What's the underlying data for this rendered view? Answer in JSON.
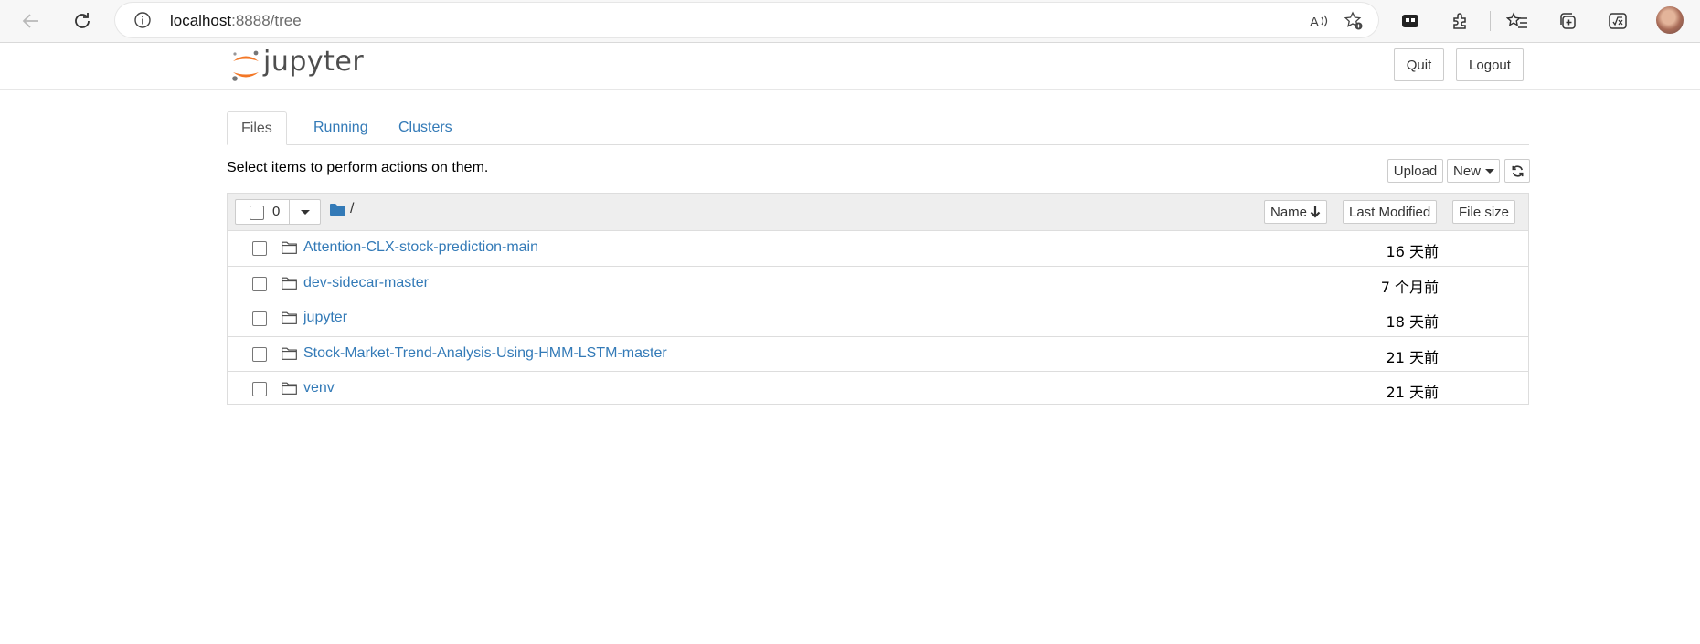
{
  "browser": {
    "url_host": "localhost",
    "url_path": ":8888/tree",
    "icons": [
      "back-arrow-icon",
      "refresh-icon",
      "info-icon",
      "read-aloud-icon",
      "add-favorite-icon",
      "puzzle-extension-icon",
      "extensions-icon",
      "favorites-icon",
      "collections-icon",
      "math-solver-icon",
      "profile-avatar"
    ]
  },
  "header": {
    "logo_text": "jupyter",
    "quit_label": "Quit",
    "logout_label": "Logout"
  },
  "tabs": [
    {
      "label": "Files",
      "active": true
    },
    {
      "label": "Running",
      "active": false
    },
    {
      "label": "Clusters",
      "active": false
    }
  ],
  "toolbar": {
    "instruction": "Select items to perform actions on them.",
    "upload_label": "Upload",
    "new_label": "New"
  },
  "list_header": {
    "selected_count": "0",
    "breadcrumb": "/",
    "sort_name": "Name",
    "sort_modified": "Last Modified",
    "sort_size": "File size"
  },
  "files": [
    {
      "name": "Attention-CLX-stock-prediction-main",
      "modified": "16 天前"
    },
    {
      "name": "dev-sidecar-master",
      "modified": "7 个月前"
    },
    {
      "name": "jupyter",
      "modified": "18 天前"
    },
    {
      "name": "Stock-Market-Trend-Analysis-Using-HMM-LSTM-master",
      "modified": "21 天前"
    },
    {
      "name": "venv",
      "modified": "21 天前"
    }
  ],
  "colors": {
    "link": "#337ab7",
    "logo_orange": "#f37726",
    "header_bg": "#eeeeee"
  }
}
